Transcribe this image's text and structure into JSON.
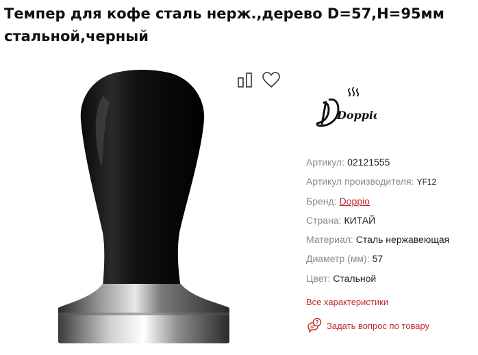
{
  "product": {
    "title": "Темпер для кофе сталь нерж.,дерево D=57,H=95мм стальной,черный"
  },
  "icons": {
    "compare": "compare-icon",
    "favorite": "heart-icon",
    "ask": "question-chat-icon"
  },
  "brand_logo": {
    "text": "Doppio"
  },
  "specs": [
    {
      "label": "Артикул:",
      "value": "02121555"
    },
    {
      "label": "Артикул производителя:",
      "value": "YF12"
    },
    {
      "label": "Бренд:",
      "value": "Doppio"
    },
    {
      "label": "Страна:",
      "value": "КИТАЙ"
    },
    {
      "label": "Материал:",
      "value": "Сталь нержавеющая"
    },
    {
      "label": "Диаметр (мм):",
      "value": "57"
    },
    {
      "label": "Цвет:",
      "value": "Стальной"
    }
  ],
  "links": {
    "all_specs": "Все характеристики",
    "ask_question": "Задать вопрос по товару"
  },
  "colors": {
    "accent": "#c02828",
    "label": "#8a8a8a"
  }
}
